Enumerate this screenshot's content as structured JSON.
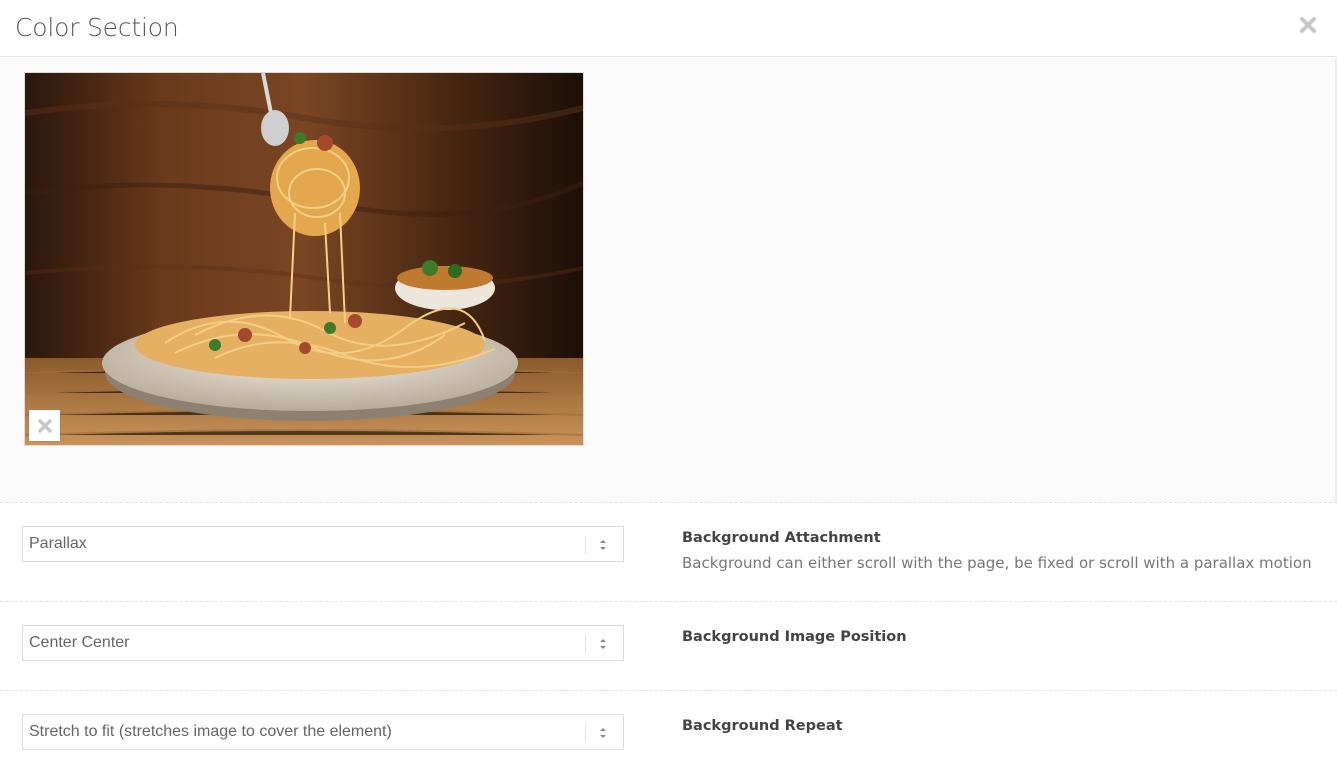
{
  "dialog": {
    "title": "Color Section",
    "close_icon": "close-icon"
  },
  "image": {
    "remove_icon": "close-icon"
  },
  "settings": [
    {
      "value": "Parallax",
      "label": "Background Attachment",
      "description": "Background can either scroll with the page, be fixed or scroll with a parallax motion"
    },
    {
      "value": "Center Center",
      "label": "Background Image Position",
      "description": ""
    },
    {
      "value": "Stretch to fit (stretches image to cover the element)",
      "label": "Background Repeat",
      "description": ""
    }
  ],
  "colors": {
    "close_icon": "#c7c7c7",
    "label": "#444444",
    "description": "#777777"
  }
}
